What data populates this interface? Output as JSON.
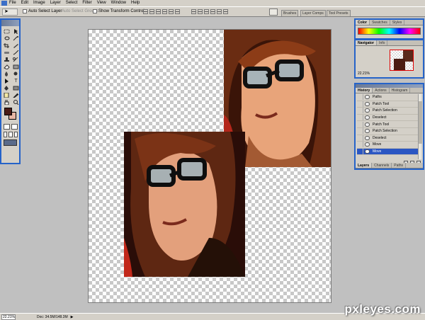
{
  "menubar": {
    "items": [
      "File",
      "Edit",
      "Image",
      "Layer",
      "Select",
      "Filter",
      "View",
      "Window",
      "Help"
    ]
  },
  "options_bar": {
    "auto_select_layer": "Auto Select Layer",
    "auto_select_groups": "Auto Select Groups",
    "show_transform_controls": "Show Transform Controls",
    "palette_well_tabs": [
      "Brushes",
      "Layer Comps",
      "Tool Presets"
    ]
  },
  "toolbox": {
    "foreground_color": "#4a1c16",
    "background_color": "#e8b7a3"
  },
  "color_palette": {
    "tabs": [
      "Color",
      "Swatches",
      "Styles"
    ]
  },
  "navigator": {
    "tabs": [
      "Navigator",
      "Info"
    ],
    "zoom": "22.21%"
  },
  "history": {
    "tabs": [
      "History",
      "Actions",
      "Histogram"
    ],
    "items": [
      {
        "label": "Paths",
        "icon": "state-icon"
      },
      {
        "label": "Patch Tool",
        "icon": "patch-icon"
      },
      {
        "label": "Patch Selection",
        "icon": "patch-icon"
      },
      {
        "label": "Deselect",
        "icon": "deselect-icon"
      },
      {
        "label": "Patch Tool",
        "icon": "patch-icon"
      },
      {
        "label": "Patch Selection",
        "icon": "patch-icon"
      },
      {
        "label": "Deselect",
        "icon": "deselect-icon"
      },
      {
        "label": "Move",
        "icon": "move-icon"
      },
      {
        "label": "Move",
        "icon": "move-icon",
        "active": true
      }
    ]
  },
  "layers_palette": {
    "tabs": [
      "Layers",
      "Channels",
      "Paths"
    ]
  },
  "status_bar": {
    "zoom": "22.21%",
    "doc": "Doc: 34.5M/148.3M"
  },
  "watermark": "pxleyes.com",
  "colors": {
    "accent": "#2563c9",
    "selection": "#2b56c2",
    "chrome": "#d4d0c8"
  }
}
